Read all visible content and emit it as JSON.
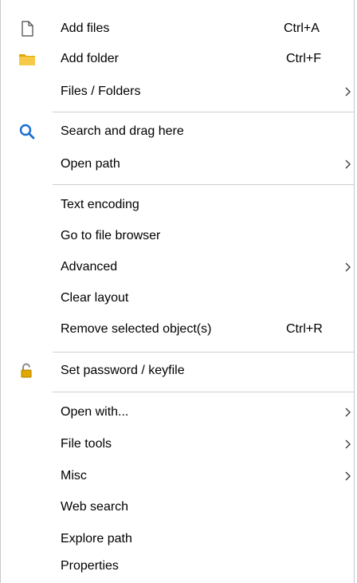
{
  "menu": {
    "items": [
      {
        "label": "Add files",
        "shortcut": "Ctrl+A",
        "icon": "file-icon"
      },
      {
        "label": "Add folder",
        "shortcut": "Ctrl+F",
        "icon": "folder-icon"
      },
      {
        "label": "Files / Folders",
        "submenu": true
      },
      {
        "label": "Search and drag here",
        "icon": "search-icon"
      },
      {
        "label": "Open path",
        "submenu": true
      },
      {
        "label": "Text encoding"
      },
      {
        "label": "Go to file browser"
      },
      {
        "label": "Advanced",
        "submenu": true
      },
      {
        "label": "Clear layout"
      },
      {
        "label": "Remove selected object(s)",
        "shortcut": "Ctrl+R"
      },
      {
        "label": "Set password / keyfile",
        "icon": "unlocked-padlock-icon"
      },
      {
        "label": "Open with...",
        "submenu": true
      },
      {
        "label": "File tools",
        "submenu": true
      },
      {
        "label": "Misc",
        "submenu": true
      },
      {
        "label": "Web search"
      },
      {
        "label": "Explore path"
      },
      {
        "label": "Properties"
      }
    ]
  },
  "colors": {
    "text": "#000000",
    "separator": "#cfcfcf",
    "border": "#c9c9c9",
    "search_icon": "#1a6fcf",
    "folder_icon": "#f5c518",
    "padlock_icon": "#e0a800"
  }
}
